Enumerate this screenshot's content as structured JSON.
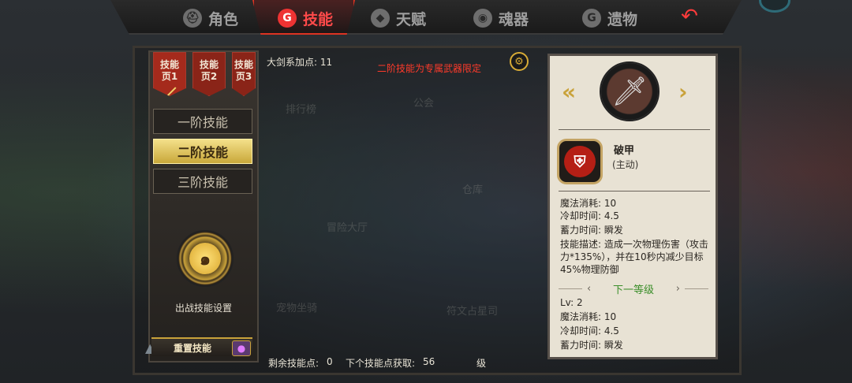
{
  "nav": {
    "tabs": [
      {
        "label": "角色",
        "icon": "helmet-icon"
      },
      {
        "label": "技能",
        "icon": "skill-swirl-icon",
        "active": true
      },
      {
        "label": "天赋",
        "icon": "talent-diamond-icon"
      },
      {
        "label": "魂器",
        "icon": "soul-drop-icon"
      },
      {
        "label": "遗物",
        "icon": "relic-swirl-icon"
      }
    ],
    "back_icon": "back-arrow-icon"
  },
  "skill_pages": [
    {
      "label": "技能\n页1",
      "active": true
    },
    {
      "label": "技能\n页2"
    },
    {
      "label": "技能\n页3"
    }
  ],
  "tiers": [
    {
      "label": "一阶技能"
    },
    {
      "label": "二阶技能",
      "active": true
    },
    {
      "label": "三阶技能"
    }
  ],
  "loadout": {
    "label": "出战技能设置",
    "icon": "golden-swirl-icon"
  },
  "reset": {
    "label": "重置技能",
    "gem_icon": "purple-gem-icon"
  },
  "header": {
    "points_label": "大剑系加点: 11",
    "notice": "二阶技能为专属武器限定"
  },
  "map_labels": [
    "排行榜",
    "公会",
    "仓库",
    "冒险大厅",
    "宠物坐骑",
    "符文占星司"
  ],
  "footer": {
    "remaining_label": "剩余技能点:",
    "remaining_value": "0",
    "next_label": "下个技能点获取:",
    "next_value": "56",
    "next_unit": "级"
  },
  "detail": {
    "weapon_icon": "sword-icon",
    "skill_icon": "broken-shield-icon",
    "name": "破甲",
    "type": "(主动)",
    "mana": "魔法消耗: 10",
    "cooldown": "冷却时间: 4.5",
    "charge": "蓄力时间: 瞬发",
    "description": "技能描述: 造成一次物理伤害（攻击力*135%），并在10秒内减少目标45%物理防御",
    "next_level_label": "下一等级",
    "next": {
      "level": "Lv: 2",
      "mana": "魔法消耗: 10",
      "cooldown": "冷却时间: 4.5",
      "charge": "蓄力时间: 瞬发"
    }
  },
  "colors": {
    "accent_red": "#ff4a4a",
    "gold": "#c9a23a",
    "next_green": "#3b8e2a"
  }
}
